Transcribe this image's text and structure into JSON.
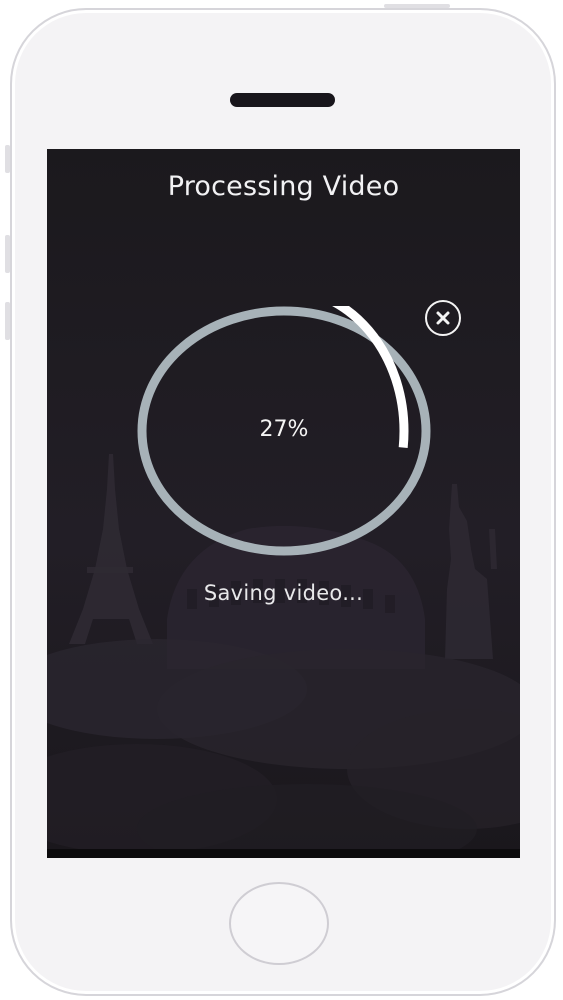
{
  "header": {
    "title": "Processing Video"
  },
  "progress": {
    "percent_label": "27%",
    "fraction": 0.27,
    "status_text": "Saving video..."
  },
  "close_button": {
    "icon": "close-icon"
  },
  "colors": {
    "screen_background": "#1c1a1f",
    "ring_track": "#a7b2b8",
    "ring_fill": "#ffffff",
    "text": "#f2f2f4"
  }
}
